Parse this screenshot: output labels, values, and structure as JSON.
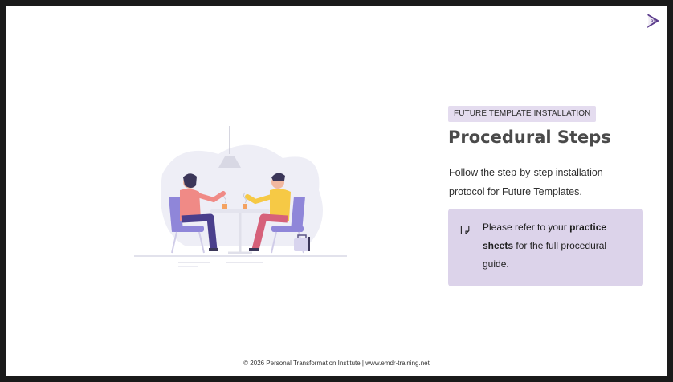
{
  "logo": {
    "text": "PTI",
    "color": "#5b3b8c"
  },
  "slide": {
    "tag": "FUTURE TEMPLATE INSTALLATION",
    "title": "Procedural Steps",
    "description": "Follow the step-by-step installation protocol for Future Templates.",
    "callout": {
      "icon": "sticky-note-icon",
      "prefix": "Please refer to your ",
      "bold": "practice sheets",
      "suffix": " for the full procedural guide."
    },
    "illustration": "two-people-meeting-at-table"
  },
  "footer": {
    "text": "© 2026 Personal Transformation Institute | www.emdr-training.net"
  },
  "colors": {
    "tag_bg": "#e4dcef",
    "callout_bg": "#dcd3ea",
    "accent": "#5b3b8c"
  }
}
